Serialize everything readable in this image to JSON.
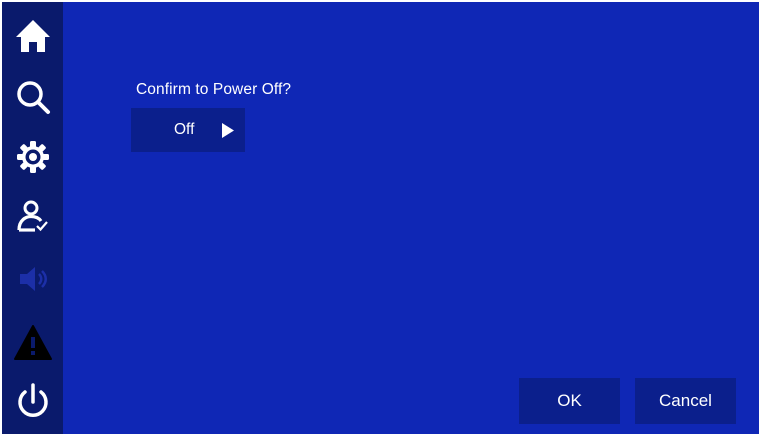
{
  "sidebar": {
    "items": [
      {
        "icon": "home-icon",
        "color": "#ffffff"
      },
      {
        "icon": "search-icon",
        "color": "#ffffff"
      },
      {
        "icon": "settings-icon",
        "color": "#ffffff"
      },
      {
        "icon": "user-check-icon",
        "color": "#ffffff"
      },
      {
        "icon": "speaker-icon",
        "color": "#1c2fa8"
      },
      {
        "icon": "alarm-icon",
        "color": "#000000"
      },
      {
        "icon": "power-icon",
        "color": "#ffffff"
      }
    ]
  },
  "dialog": {
    "prompt": "Confirm to Power Off?",
    "selected_value": "Off"
  },
  "buttons": {
    "ok": "OK",
    "cancel": "Cancel"
  },
  "colors": {
    "background": "#0f27b5",
    "sidebar": "#0a1a6c",
    "control": "#0b1f8c",
    "text": "#ffffff"
  }
}
